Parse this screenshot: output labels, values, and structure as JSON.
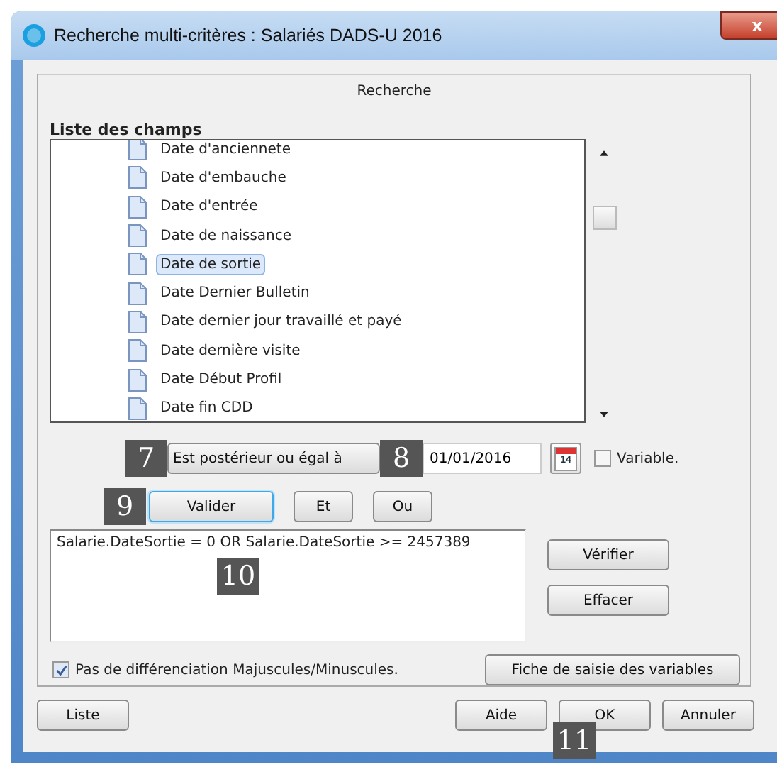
{
  "window": {
    "title": "Recherche multi-critères : Salariés DADS-U 2016",
    "close": "x"
  },
  "tab": {
    "label": "Recherche"
  },
  "fields_list": {
    "label": "Liste des champs",
    "items": [
      {
        "label": "Date d'anciennete",
        "selected": false
      },
      {
        "label": "Date d'embauche",
        "selected": false
      },
      {
        "label": "Date d'entrée",
        "selected": false
      },
      {
        "label": "Date de naissance",
        "selected": false
      },
      {
        "label": "Date de sortie",
        "selected": true
      },
      {
        "label": "Date Dernier Bulletin",
        "selected": false
      },
      {
        "label": "Date dernier jour travaillé et payé",
        "selected": false
      },
      {
        "label": "Date dernière visite",
        "selected": false
      },
      {
        "label": "Date Début Profil",
        "selected": false
      },
      {
        "label": "Date fin CDD",
        "selected": false
      }
    ]
  },
  "condition": {
    "value": "Est postérieur ou égal à",
    "callout": "7"
  },
  "date_field": {
    "value": "01/01/2016",
    "callout": "8",
    "calendar_day": "14"
  },
  "variable_checkbox": {
    "label": "Variable.",
    "checked": false
  },
  "operator_buttons": [
    {
      "label": "Valider",
      "callout": "9",
      "focused": true
    },
    {
      "label": "Et",
      "focused": false
    },
    {
      "label": "Ou",
      "focused": false
    }
  ],
  "expression": {
    "value": "Salarie.DateSortie =  0  OR Salarie.DateSortie >=  2457389",
    "callout": "10"
  },
  "side_buttons": [
    "Vérifier",
    "Effacer"
  ],
  "case_checkbox": {
    "label": "Pas de différenciation Majuscules/Minuscules.",
    "checked": true
  },
  "variables_button": "Fiche de saisie des variables",
  "footer": {
    "left": "Liste",
    "buttons": [
      {
        "label": "Aide"
      },
      {
        "label": "OK",
        "callout": "11"
      },
      {
        "label": "Annuler"
      }
    ]
  }
}
